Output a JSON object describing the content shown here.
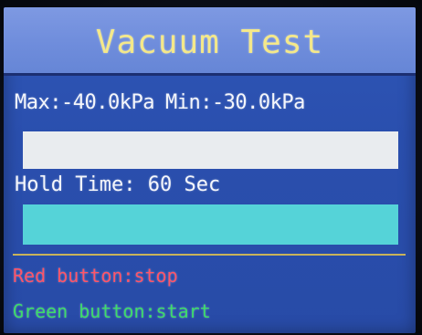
{
  "screen": {
    "title": "Vacuum Test"
  },
  "pressure": {
    "max_label": "Max:",
    "max_value": "-40.0kPa",
    "min_label": "Min:",
    "min_value": "-30.0kPa",
    "bar_fill_fraction": 1.0
  },
  "hold": {
    "label": "Hold Time:",
    "value": "60",
    "unit": "Sec",
    "bar_fill_fraction": 1.0
  },
  "hints": {
    "red": "Red button:stop",
    "green": "Green button:start"
  },
  "colors": {
    "screen_bg": "#2a4fae",
    "title_bg": "#6f8ddc",
    "title_text": "#f4e88a",
    "pressure_bar": "#e9ecef",
    "time_bar": "#55d3d8",
    "divider": "#c9b35a",
    "red_hint": "#ff5468",
    "green_hint": "#3ddc6a"
  }
}
